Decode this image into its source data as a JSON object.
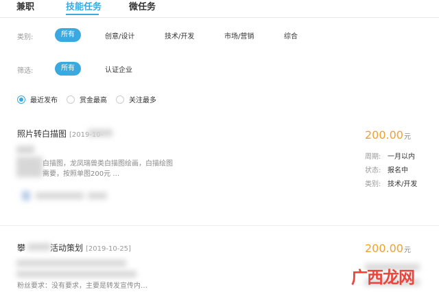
{
  "tabs": [
    {
      "label": "兼职"
    },
    {
      "label": "技能任务"
    },
    {
      "label": "微任务"
    }
  ],
  "category": {
    "label": "类别:",
    "options": [
      "所有",
      "创意/设计",
      "技术/开发",
      "市场/营销",
      "综合"
    ]
  },
  "filter": {
    "label": "筛选:",
    "options": [
      "所有",
      "认证企业"
    ]
  },
  "sort": {
    "options": [
      "最近发布",
      "赏金最高",
      "关注最多"
    ]
  },
  "tasks": [
    {
      "title": "照片转白描图",
      "date": "[2019-10-",
      "desc_line1": "白描图，龙凤瑞兽类白描图绘画，白描绘图",
      "desc_line2": "需要，按照单图200元 …",
      "price": "200.00",
      "unit": "元",
      "period_label": "周期:",
      "period": "一月以内",
      "status_label": "状态:",
      "status": "报名中",
      "type_label": "类别:",
      "type": "技术/开发"
    },
    {
      "title_prefix": "攀",
      "title_suffix": "活动策划",
      "date": "[2019-10-25]",
      "desc_line": "粉丝要求：没有要求，主要是转发宣传内…",
      "price": "200.00",
      "unit": "元"
    }
  ],
  "watermark": "广西龙网"
}
